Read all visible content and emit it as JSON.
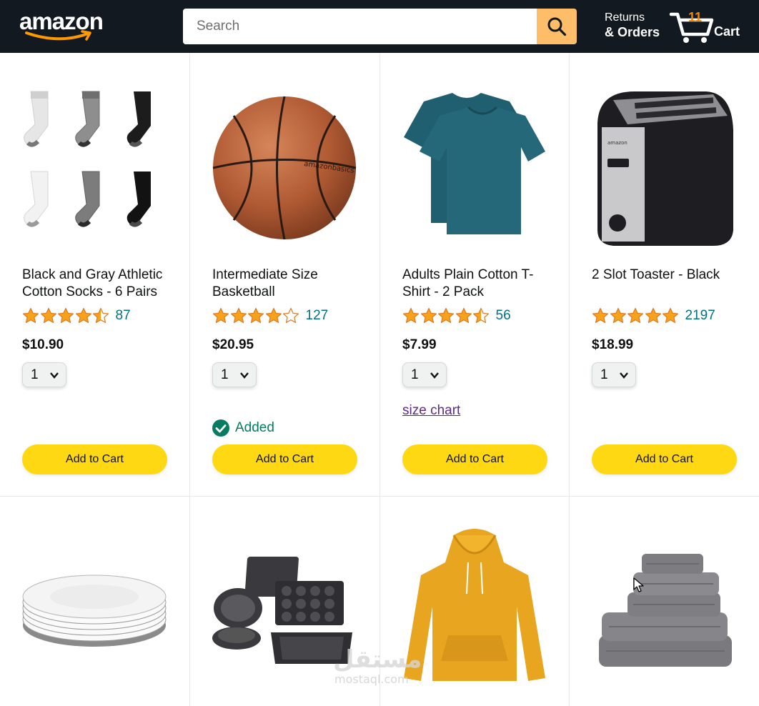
{
  "header": {
    "logo": "amazon",
    "search_placeholder": "Search",
    "search_icon": "search-icon",
    "returns_top": "Returns",
    "returns_bottom": "& Orders",
    "cart_count": "11",
    "cart_label": "Cart"
  },
  "colors": {
    "header_bg": "#131921",
    "search_button": "#febd69",
    "add_to_cart": "#ffd814",
    "rating_count": "#007185",
    "added": "#067d62",
    "cart_count": "#f08804",
    "link": "#5b2c83"
  },
  "products": [
    {
      "name": "Black and Gray Athletic Cotton Socks - 6 Pairs",
      "image": "socks",
      "rating": 4.5,
      "rating_count": "87",
      "price": "$10.90",
      "quantity": "1",
      "extra_link": "",
      "added": "",
      "button": "Add to Cart"
    },
    {
      "name": "Intermediate Size Basketball",
      "image": "basketball",
      "rating": 4,
      "rating_count": "127",
      "price": "$20.95",
      "quantity": "1",
      "extra_link": "",
      "added": "Added",
      "button": "Add to Cart"
    },
    {
      "name": "Adults Plain Cotton T-Shirt - 2 Pack",
      "image": "t-shirt",
      "rating": 4.5,
      "rating_count": "56",
      "price": "$7.99",
      "quantity": "1",
      "extra_link": "size chart",
      "added": "",
      "button": "Add to Cart"
    },
    {
      "name": "2 Slot Toaster - Black",
      "image": "toaster",
      "rating": 5,
      "rating_count": "2197",
      "price": "$18.99",
      "quantity": "1",
      "extra_link": "",
      "added": "",
      "button": "Add to Cart"
    }
  ],
  "row2_images": [
    "plates",
    "bakeware",
    "hoodie",
    "towels"
  ],
  "watermark": {
    "arabic": "مستقل",
    "latin": "mostaql.com"
  }
}
